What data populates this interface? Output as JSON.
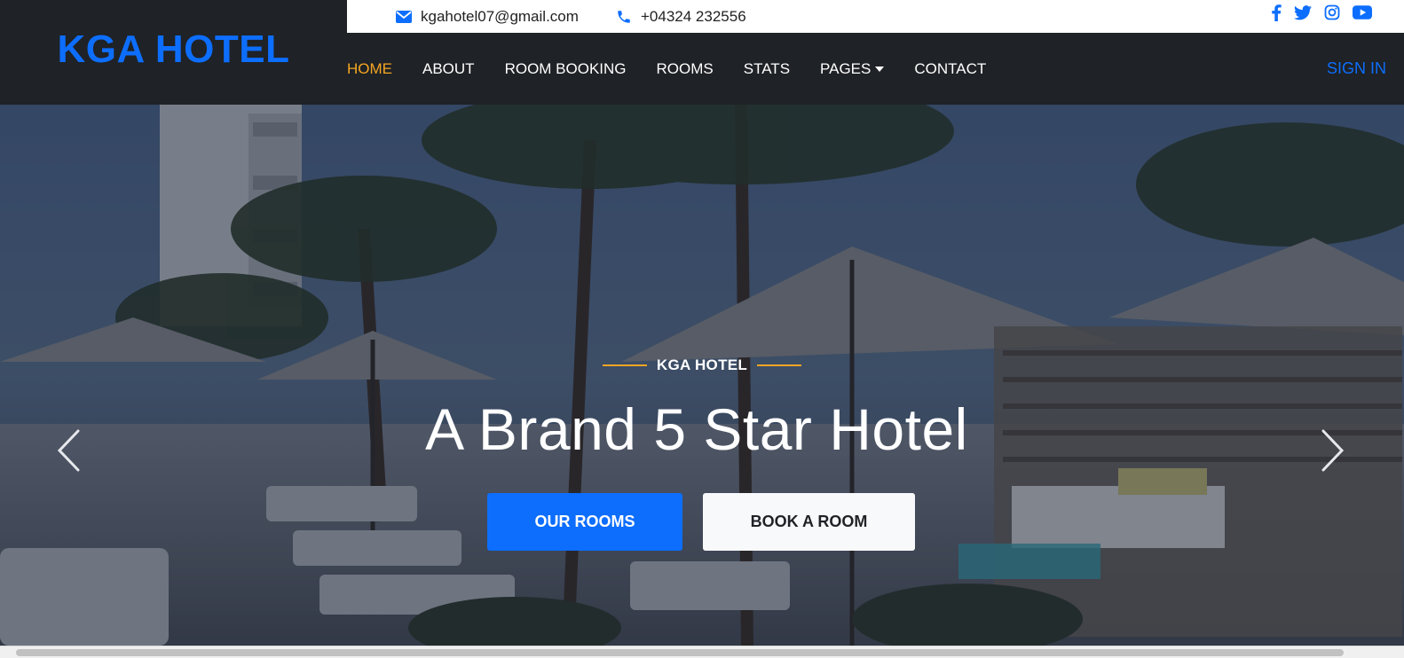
{
  "brand": {
    "title": "KGA HOTEL"
  },
  "topbar": {
    "email": "kgahotel07@gmail.com",
    "phone": "+04324 232556",
    "social": [
      "facebook-icon",
      "twitter-icon",
      "instagram-icon",
      "youtube-icon"
    ]
  },
  "nav": {
    "items": [
      {
        "label": "HOME",
        "active": true
      },
      {
        "label": "ABOUT"
      },
      {
        "label": "ROOM BOOKING"
      },
      {
        "label": "ROOMS"
      },
      {
        "label": "STATS"
      },
      {
        "label": "PAGES",
        "dropdown": true
      },
      {
        "label": "CONTACT"
      }
    ],
    "sign_in": "SIGN IN"
  },
  "hero": {
    "eyebrow": "KGA HOTEL",
    "headline": "A Brand 5 Star Hotel",
    "primary_button": "OUR ROOMS",
    "secondary_button": "BOOK A ROOM"
  },
  "colors": {
    "brand_blue": "#0d6efd",
    "accent_orange": "#f5a623",
    "dark_bg": "#1f2226"
  }
}
